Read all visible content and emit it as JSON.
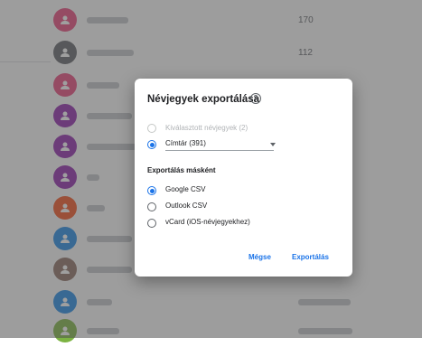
{
  "contacts_list": {
    "rows": [
      {
        "count": "170",
        "color": "#e8457a"
      },
      {
        "count": "112",
        "color": "#5f6368"
      },
      {
        "count": "",
        "color": "#e8457a"
      },
      {
        "count": "",
        "color": "#8e24aa"
      },
      {
        "count": "",
        "color": "#8e24aa"
      },
      {
        "count": "",
        "color": "#8e24aa"
      },
      {
        "count": "",
        "color": "#f4511e"
      },
      {
        "count": "",
        "color": "#1e88e5"
      },
      {
        "count": "",
        "color": "#8d6e63"
      },
      {
        "count": "",
        "color": "#1e88e5"
      },
      {
        "count": "",
        "color": "#7cb342"
      }
    ]
  },
  "export_dialog": {
    "title": "Névjegyek exportálása",
    "help_icon": "help-circle-icon",
    "source_options": {
      "selected_contacts": "Kiválasztott névjegyek (2)",
      "directory": "Címtár (391)"
    },
    "format_heading": "Exportálás másként",
    "format_options": {
      "google_csv": "Google CSV",
      "outlook_csv": "Outlook CSV",
      "vcard": "vCard (iOS-névjegyekhez)"
    },
    "cancel_label": "Mégse",
    "export_label": "Exportálás",
    "accent_color": "#1a73e8"
  }
}
